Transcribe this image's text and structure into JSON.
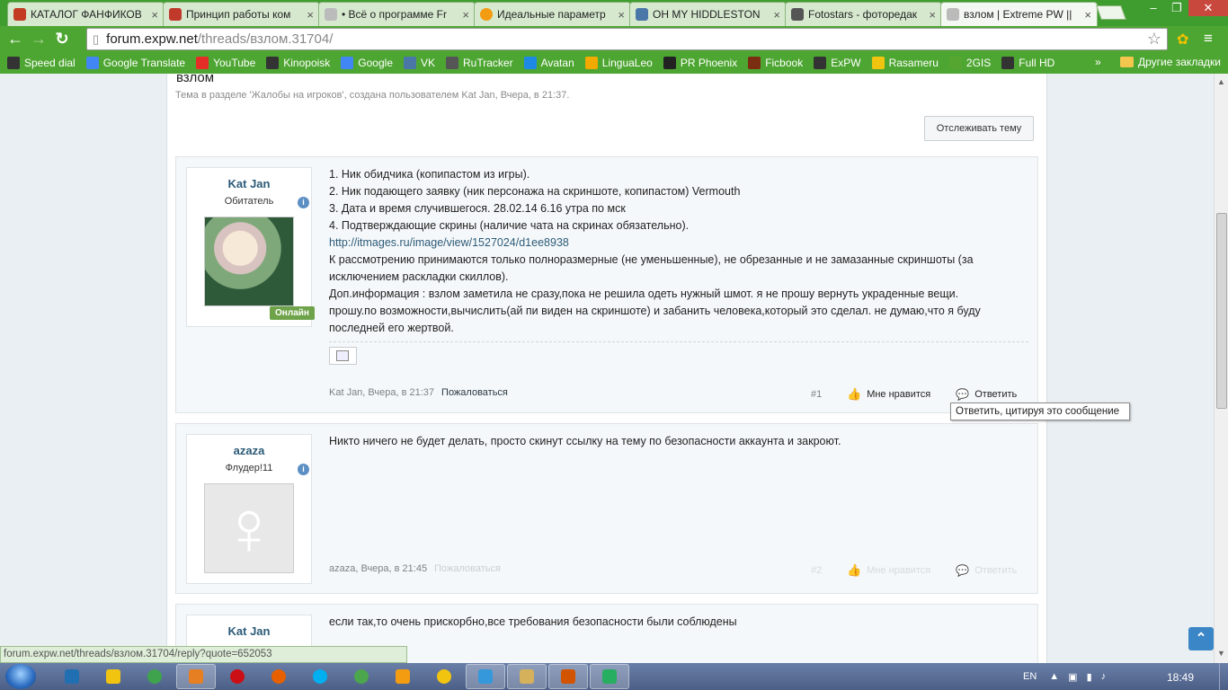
{
  "browser": {
    "tabs": [
      {
        "title": "КАТАЛОГ ФАНФИКОВ",
        "color": "#c23b22",
        "active": false
      },
      {
        "title": "Принцип работы ком",
        "color": "#c0392b",
        "active": false
      },
      {
        "title": "• Всё о программе Fr",
        "color": "#bbbbbb",
        "active": false
      },
      {
        "title": "Идеальные параметр",
        "color": "#f39c12",
        "active": false
      },
      {
        "title": "OH MY HIDDLESTON",
        "color": "#4a76a8",
        "active": false
      },
      {
        "title": "Fotostars - фоторедак",
        "color": "#555555",
        "active": false
      },
      {
        "title": "взлом | Extreme PW ||",
        "color": "#bbbbbb",
        "active": true
      }
    ],
    "tab_close": "×",
    "window_controls": [
      "–",
      "❐",
      "✕"
    ],
    "nav": {
      "back": "←",
      "forward": "→",
      "reload": "↻"
    },
    "url_host": "forum.expw.net",
    "url_path": "/threads/взлом.31704/",
    "bookmark_star": "☆",
    "menu_glyph": "≡",
    "bookmarks": [
      {
        "label": "Speed dial",
        "color": "#333333"
      },
      {
        "label": "Google Translate",
        "color": "#4285f4"
      },
      {
        "label": "YouTube",
        "color": "#e52d27"
      },
      {
        "label": "Kinopoisk",
        "color": "#333333"
      },
      {
        "label": "Google",
        "color": "#4285f4"
      },
      {
        "label": "VK",
        "color": "#4a76a8"
      },
      {
        "label": "RuTracker",
        "color": "#555555"
      },
      {
        "label": "Avatan",
        "color": "#1e88e5"
      },
      {
        "label": "LinguaLeo",
        "color": "#f2a900"
      },
      {
        "label": "PR Phoenix",
        "color": "#222222"
      },
      {
        "label": "Ficbook",
        "color": "#7b2d12"
      },
      {
        "label": "ExPW",
        "color": "#333333"
      },
      {
        "label": "Rasameru",
        "color": "#f1c40f"
      },
      {
        "label": "2GIS",
        "color": "#55a630"
      },
      {
        "label": "Full HD",
        "color": "#333333"
      }
    ],
    "bookmarks_more": "»",
    "other_bookmarks": "Другие закладки",
    "status_url": "forum.expw.net/threads/взлом.31704/reply?quote=652053"
  },
  "thread": {
    "title": "взлом",
    "description": "Тема в разделе 'Жалобы на игроков', создана пользователем Kat Jan, Вчера, в 21:37.",
    "watch_button": "Отслеживать тему"
  },
  "posts": [
    {
      "username": "Kat Jan",
      "user_title": "Обитатель",
      "online_badge": "Онлайн",
      "lines": [
        "1. Ник обидчика (копипастом из игры).",
        "2. Ник подающего заявку (ник персонажа на скриншоте, копипастом) Vermouth",
        "3. Дата и время случившегося. 28.02.14 6.16 утра по мск",
        "4. Подтверждающие скрины (наличие чата на скринах обязательно).",
        "http://itmages.ru/image/view/1527024/d1ee8938",
        "К рассмотрению принимаются только полноразмерные (не уменьшенные), не обрезанные и не замазанные скриншоты (за",
        "исключением раскладки скиллов).",
        "Доп.информация : взлом заметила не сразу,пока не решила одеть нужный шмот. я не прошу вернуть украденные вещи.",
        "прошу.по возможности,вычислить(ай пи виден на скриншоте) и забанить человека,который это сделал. не думаю,что я буду",
        "последней его жертвой."
      ],
      "meta_author": "Kat Jan,",
      "meta_time": "Вчера, в 21:37",
      "report": "Пожаловаться",
      "number": "#1",
      "like": "Мне нравится",
      "reply": "Ответить"
    },
    {
      "username": "azaza",
      "user_title": "Флудер!11",
      "lines": [
        "Никто ничего не будет делать, просто скинут ссылку на тему по безопасности аккаунта и закроют."
      ],
      "meta_author": "azaza,",
      "meta_time": "Вчера, в 21:45",
      "report": "Пожаловаться",
      "number": "#2",
      "like": "Мне нравится",
      "reply": "Ответить"
    },
    {
      "username": "Kat Jan",
      "lines": [
        "если так,то очень прискорбно,все требования безопасности были соблюдены"
      ]
    }
  ],
  "tooltip": "Ответить, цитируя это сообщение",
  "info_glyph": "i",
  "female_symbol": "♀",
  "scroll_to_top": "⌃",
  "taskbar": {
    "language": "EN",
    "time": "18:49",
    "apps": [
      {
        "name": "photoshop",
        "color": "#1f6fb2"
      },
      {
        "name": "norton",
        "color": "#f1c40f"
      },
      {
        "name": "chrome",
        "color": "#3fa34d"
      },
      {
        "name": "winamp",
        "color": "#e67e22"
      },
      {
        "name": "opera",
        "color": "#cc0f16"
      },
      {
        "name": "firefox",
        "color": "#e66000"
      },
      {
        "name": "skype",
        "color": "#00aff0"
      },
      {
        "name": "utorrent",
        "color": "#4ca64c"
      },
      {
        "name": "aimp",
        "color": "#f39c12"
      },
      {
        "name": "radiation",
        "color": "#f1c40f"
      },
      {
        "name": "kmplayer",
        "color": "#3498db"
      },
      {
        "name": "explorer",
        "color": "#d4b15a"
      },
      {
        "name": "paint",
        "color": "#d35400"
      },
      {
        "name": "monitor",
        "color": "#27ae60"
      }
    ]
  }
}
